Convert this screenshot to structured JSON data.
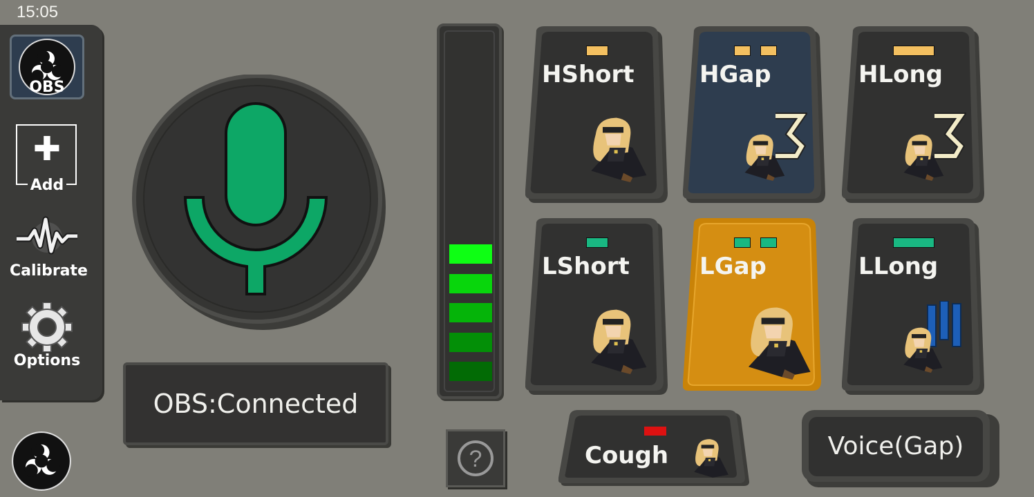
{
  "status_bar": {
    "time": "15:05"
  },
  "sidebar": {
    "items": [
      {
        "label": "OBS",
        "icon": "obs-logo-icon",
        "selected": true
      },
      {
        "label": "Add",
        "icon": "plus-icon"
      },
      {
        "label": "Calibrate",
        "icon": "waveform-icon"
      },
      {
        "label": "Options",
        "icon": "gear-icon"
      }
    ]
  },
  "mic": {
    "icon": "microphone-icon",
    "color": "#0da766"
  },
  "obs_status": {
    "text": "OBS:Connected"
  },
  "level_meter": {
    "segments_lit": 5,
    "segments_total": 13
  },
  "keys": [
    {
      "label": "HShort",
      "indicator_color": "#f4c060",
      "indicator_count": 1,
      "indicator_style": "short",
      "state": "normal"
    },
    {
      "label": "HGap",
      "indicator_color": "#f4c060",
      "indicator_count": 2,
      "indicator_style": "gap",
      "state": "active-blue"
    },
    {
      "label": "HLong",
      "indicator_color": "#f4c060",
      "indicator_count": 1,
      "indicator_style": "long",
      "state": "normal"
    },
    {
      "label": "LShort",
      "indicator_color": "#19b882",
      "indicator_count": 1,
      "indicator_style": "short",
      "state": "normal"
    },
    {
      "label": "LGap",
      "indicator_color": "#19b882",
      "indicator_count": 2,
      "indicator_style": "gap",
      "state": "selected-orange"
    },
    {
      "label": "LLong",
      "indicator_color": "#19b882",
      "indicator_count": 1,
      "indicator_style": "long",
      "state": "normal"
    }
  ],
  "cough_key": {
    "label": "Cough",
    "indicator_color": "#dd1111"
  },
  "voice_button": {
    "label": "Voice(Gap)"
  },
  "help": {
    "icon": "question-icon"
  },
  "colors": {
    "background": "#807f78",
    "key_dark": "#313130",
    "key_blue": "#2e3d4f",
    "key_orange": "#d58e12",
    "accent_green": "#0da766"
  }
}
